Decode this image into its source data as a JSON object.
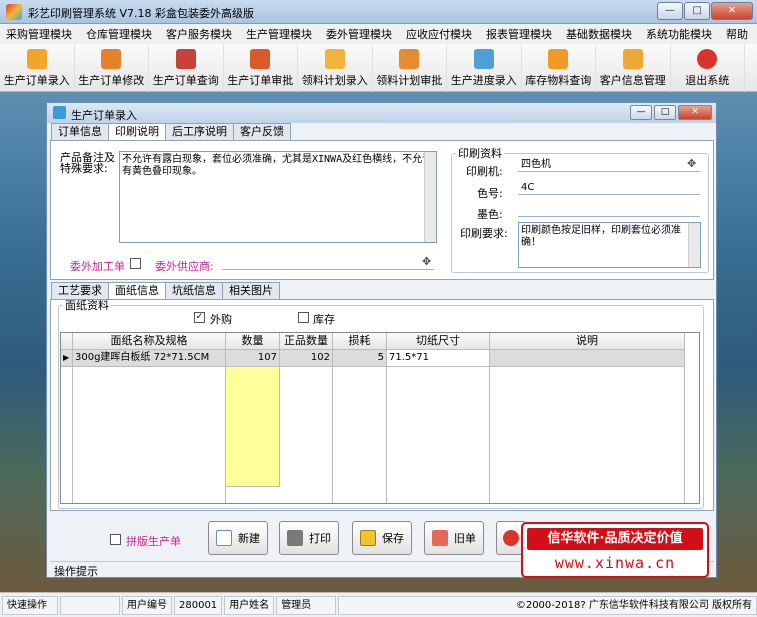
{
  "app": {
    "title": "彩艺印刷管理系统   V7.18 彩盒包装委外高级版",
    "window_buttons": [
      "—",
      "□",
      "✕"
    ]
  },
  "menu": [
    "采购管理模块",
    "仓库管理模块",
    "客户服务模块",
    "生产管理模块",
    "委外管理模块",
    "应收应付模块",
    "报表管理模块",
    "基础数据模块",
    "系统功能模块",
    "帮助"
  ],
  "toolbar": [
    {
      "label": "生产订单录入",
      "icon": "order-entry-icon",
      "color": "#f2a42b"
    },
    {
      "label": "生产订单修改",
      "icon": "order-edit-icon",
      "color": "#e5812b"
    },
    {
      "label": "生产订单查询",
      "icon": "order-query-icon",
      "color": "#c9423a"
    },
    {
      "label": "生产订单审批",
      "icon": "order-approve-icon",
      "color": "#d95b2a"
    },
    {
      "label": "领料计划录入",
      "icon": "material-plan-icon",
      "color": "#f0b43c"
    },
    {
      "label": "领料计划审批",
      "icon": "material-approve-icon",
      "color": "#e58c2f"
    },
    {
      "label": "生产进度录入",
      "icon": "progress-icon",
      "color": "#4f9fd9"
    },
    {
      "label": "库存物料查询",
      "icon": "inventory-icon",
      "color": "#f39a25"
    },
    {
      "label": "客户信息管理",
      "icon": "customer-icon",
      "color": "#f0a834"
    },
    {
      "label": "退出系统",
      "icon": "exit-icon",
      "color": "#d8342c"
    }
  ],
  "child": {
    "title": "生产订单录入",
    "top_tabs": [
      "订单信息",
      "印刷说明",
      "后工序说明",
      "客户反馈"
    ],
    "active_top_tab": 1,
    "notes_label": "产品备注及\n特殊要求:",
    "notes_text": "不允许有露白现象，套位必须准确，尤其是XINWA及红色横线，不允许有黄色叠印现象。",
    "outsource_label": "委外加工单",
    "supplier_label": "委外供应商:",
    "supplier_value": "",
    "print_group": "印刷资料",
    "printer_label": "印刷机:",
    "printer_value": "四色机",
    "colors_label": "色号:",
    "colors_value": "4C",
    "ink_label": "墨色:",
    "ink_value": "",
    "req_label": "印刷要求:",
    "req_value": "印刷颜色按足旧样，印刷套位必须准确！",
    "bottom_tabs": [
      "工艺要求",
      "面纸信息",
      "坑纸信息",
      "相关图片"
    ],
    "active_bottom_tab": 1,
    "paper_group": "面纸资料",
    "buy_label": "外购",
    "stock_label": "库存",
    "buy_checked": "✓",
    "grid_headers": [
      "面纸名称及规格",
      "数量",
      "正品数量",
      "损耗",
      "切纸尺寸",
      "说明"
    ],
    "grid_rows": [
      [
        "300g建晖白板纸 72*71.5CM",
        "107",
        "102",
        "5",
        "71.5*71",
        ""
      ]
    ],
    "reprint_label": "拼版生产单",
    "buttons": [
      {
        "label": "新建",
        "icon": "new-doc-icon"
      },
      {
        "label": "打印",
        "icon": "printer-icon"
      },
      {
        "label": "保存",
        "icon": "save-icon"
      },
      {
        "label": "旧单",
        "icon": "old-order-icon"
      }
    ],
    "hint_label": "操作提示"
  },
  "status": {
    "quick_op": "快速操作",
    "user_no_label": "用户编号",
    "user_no": "280001",
    "user_name_label": "用户姓名",
    "user_name": "管理员",
    "copyright": "©2000-2018?  广东信华软件科技有限公司   版权所有"
  },
  "promo": {
    "line1": "信华软件·品质决定价值",
    "line2": "www.xinwa.cn"
  }
}
